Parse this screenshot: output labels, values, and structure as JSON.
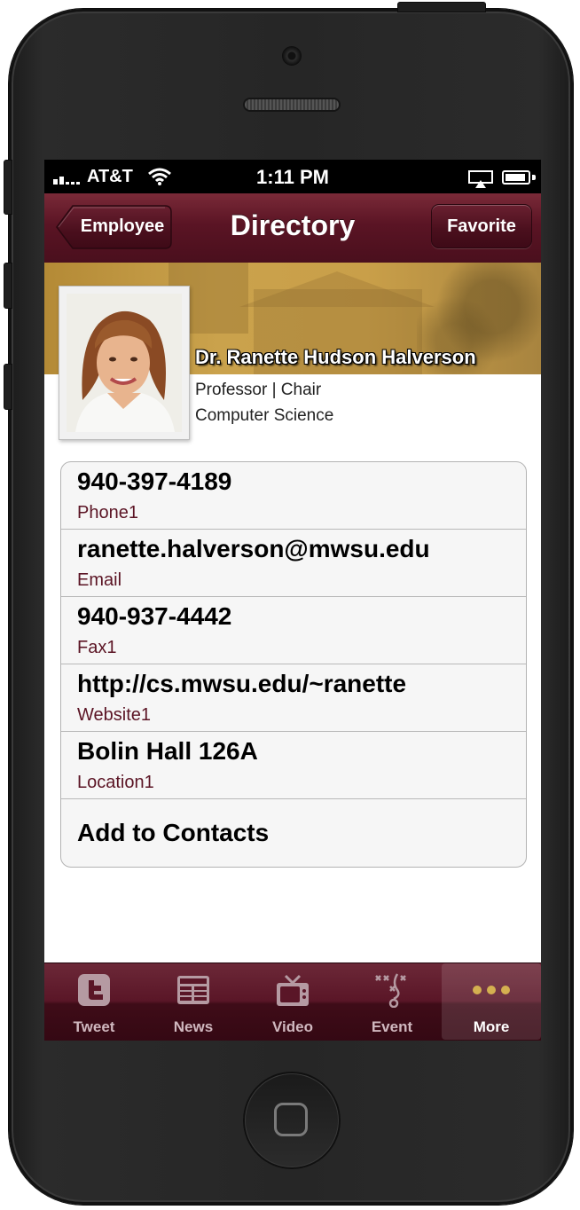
{
  "status_bar": {
    "carrier": "AT&T",
    "time": "1:11 PM"
  },
  "nav": {
    "back_label": "Employee",
    "title": "Directory",
    "favorite_label": "Favorite"
  },
  "profile": {
    "name": "Dr. Ranette Hudson Halverson",
    "title": "Professor | Chair",
    "department": "Computer Science"
  },
  "details": [
    {
      "value": "940-397-4189",
      "label": "Phone1"
    },
    {
      "value": "ranette.halverson@mwsu.edu",
      "label": "Email"
    },
    {
      "value": "940-937-4442",
      "label": "Fax1"
    },
    {
      "value": "http://cs.mwsu.edu/~ranette",
      "label": "Website1"
    },
    {
      "value": "Bolin Hall 126A",
      "label": "Location1"
    }
  ],
  "add_contacts_label": "Add to Contacts",
  "tabs": [
    {
      "label": "Tweet",
      "icon": "twitter-icon"
    },
    {
      "label": "News",
      "icon": "newspaper-icon"
    },
    {
      "label": "Video",
      "icon": "tv-icon"
    },
    {
      "label": "Event",
      "icon": "playbook-icon"
    },
    {
      "label": "More",
      "icon": "more-dots-icon",
      "active": true
    }
  ],
  "colors": {
    "maroon": "#5a1424",
    "gold": "#c99f49",
    "active_dots": "#d4b050"
  }
}
